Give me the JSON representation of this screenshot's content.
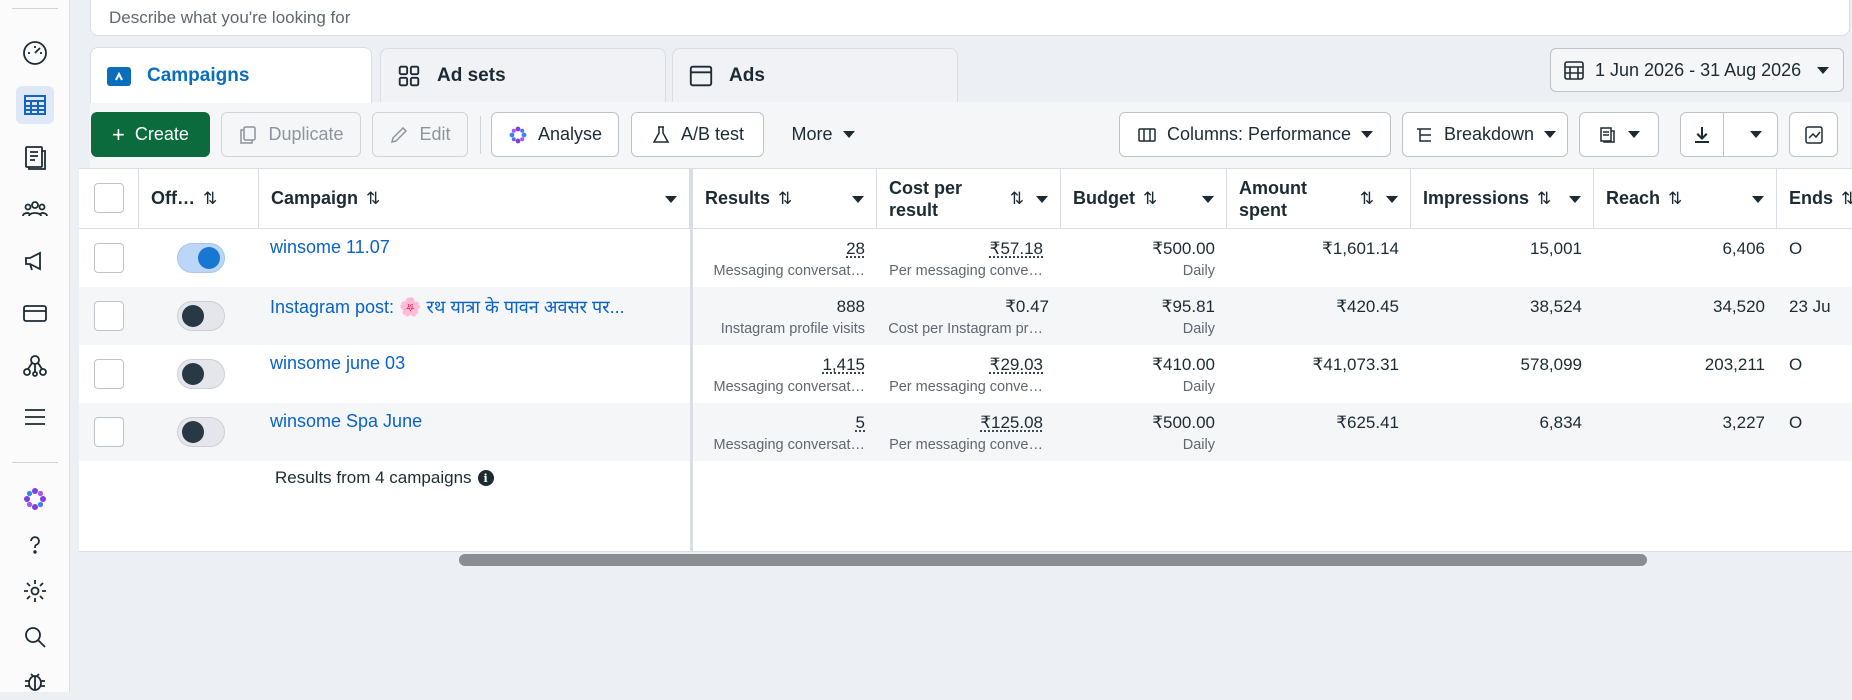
{
  "search": {
    "placeholder": "Describe what you're looking for"
  },
  "tabs": [
    {
      "label": "Campaigns",
      "icon": "campaign-folder-icon",
      "active": true
    },
    {
      "label": "Ad sets",
      "icon": "grid-icon",
      "active": false
    },
    {
      "label": "Ads",
      "icon": "ad-window-icon",
      "active": false
    }
  ],
  "date_range": {
    "label": "1 Jun 2026 - 31 Aug 2026"
  },
  "toolbar": {
    "create": "Create",
    "duplicate": "Duplicate",
    "edit": "Edit",
    "analyse": "Analyse",
    "ab_test": "A/B test",
    "more": "More",
    "columns": "Columns: Performance",
    "breakdown": "Breakdown"
  },
  "table": {
    "headers": {
      "off": "Off…",
      "campaign": "Campaign",
      "results": "Results",
      "cost_per_result": "Cost per result",
      "budget": "Budget",
      "amount_spent": "Amount spent",
      "impressions": "Impressions",
      "reach": "Reach",
      "ends": "Ends"
    },
    "rows": [
      {
        "toggle_on": true,
        "campaign": "winsome 11.07",
        "results": "28",
        "results_sub": "Messaging conversat…",
        "cost": "₹57.18",
        "cost_sub": "Per messaging conve…",
        "budget": "₹500.00",
        "budget_sub": "Daily",
        "spent": "₹1,601.14",
        "impressions": "15,001",
        "reach": "6,406",
        "ends": "O"
      },
      {
        "toggle_on": false,
        "campaign": "Instagram post: 🌸 रथ यात्रा के पावन अवसर पर...",
        "results": "888",
        "results_sub": "Instagram profile visits",
        "cost": "₹0.47",
        "cost_sub": "Cost per Instagram pr…",
        "budget": "₹95.81",
        "budget_sub": "Daily",
        "spent": "₹420.45",
        "impressions": "38,524",
        "reach": "34,520",
        "ends": "23 Ju"
      },
      {
        "toggle_on": false,
        "campaign": "winsome june 03",
        "results": "1,415",
        "results_sub": "Messaging conversat…",
        "cost": "₹29.03",
        "cost_sub": "Per messaging conve…",
        "budget": "₹410.00",
        "budget_sub": "Daily",
        "spent": "₹41,073.31",
        "impressions": "578,099",
        "reach": "203,211",
        "ends": "O"
      },
      {
        "toggle_on": false,
        "campaign": "winsome Spa June",
        "results": "5",
        "results_sub": "Messaging conversat…",
        "cost": "₹125.08",
        "cost_sub": "Per messaging conve…",
        "budget": "₹500.00",
        "budget_sub": "Daily",
        "spent": "₹625.41",
        "impressions": "6,834",
        "reach": "3,227",
        "ends": "O"
      }
    ],
    "footer": "Results from 4 campaigns"
  },
  "colors": {
    "accent": "#0a6ebd",
    "create": "#0c6b3d",
    "link": "#0a62c9"
  }
}
